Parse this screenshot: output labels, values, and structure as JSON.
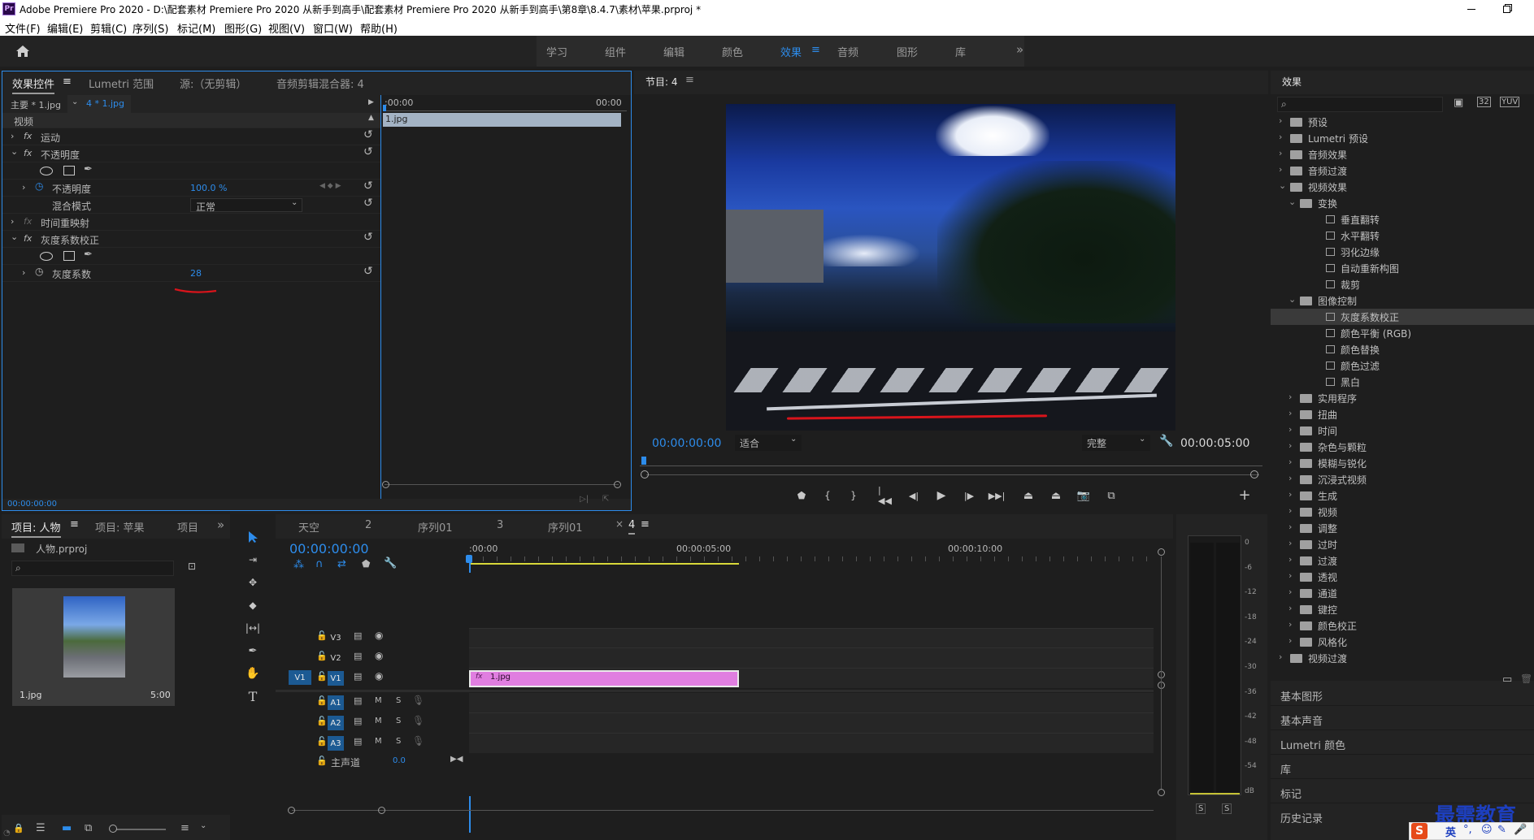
{
  "window": {
    "title": "Adobe Premiere Pro 2020 - D:\\配套素材 Premiere Pro 2020 从新手到高手\\配套素材 Premiere Pro 2020 从新手到高手\\第8章\\8.4.7\\素材\\苹果.prproj *",
    "app_icon_text": "Pr"
  },
  "menu": [
    "文件(F)",
    "编辑(E)",
    "剪辑(C)",
    "序列(S)",
    "标记(M)",
    "图形(G)",
    "视图(V)",
    "窗口(W)",
    "帮助(H)"
  ],
  "workspaces": [
    "学习",
    "组件",
    "编辑",
    "颜色",
    "效果",
    "音频",
    "图形",
    "库"
  ],
  "active_workspace": "效果",
  "effect_controls": {
    "tabs": [
      "效果控件",
      "Lumetri 范围",
      "源:（无剪辑）",
      "音频剪辑混合器: 4"
    ],
    "master_clip": "主要 * 1.jpg",
    "seq_clip": "4 * 1.jpg",
    "time_start": ":00:00",
    "time_end": "00:00",
    "clip_bar": "1.jpg",
    "section_video": "视频",
    "motion": "运动",
    "opacity": "不透明度",
    "opacity_param": "不透明度",
    "opacity_value": "100.0 %",
    "blend_mode_label": "混合模式",
    "blend_mode_value": "正常",
    "time_remap": "时间重映射",
    "gamma_effect": "灰度系数校正",
    "gamma_param": "灰度系数",
    "gamma_value": "28",
    "timecode": "00:00:00:00",
    "fx_label": "fx"
  },
  "program": {
    "title": "节目: 4",
    "timecode": "00:00:00:00",
    "fit": "适合",
    "quality": "完整",
    "duration": "00:00:05:00"
  },
  "project": {
    "tabs": [
      "项目: 人物",
      "项目: 苹果",
      "项目"
    ],
    "file": "人物.prproj",
    "clip_name": "1.jpg",
    "clip_duration": "5:00"
  },
  "timeline": {
    "tabs": [
      "天空",
      "2",
      "序列01",
      "3",
      "序列01",
      "4"
    ],
    "timecode": "00:00:00:00",
    "ruler": [
      ":00:00",
      "00:00:05:00",
      "00:00:10:00"
    ],
    "tracks_video": [
      "V3",
      "V2",
      "V1"
    ],
    "tracks_audio": [
      "A1",
      "A2",
      "A3"
    ],
    "source_patch": "V1",
    "master": "主声道",
    "master_value": "0.0",
    "clip": "1.jpg",
    "m_label": "M",
    "s_label": "S"
  },
  "meter": {
    "labels": [
      "0",
      "-6",
      "-12",
      "-18",
      "-24",
      "-30",
      "-36",
      "-42",
      "-48",
      "-54",
      "dB"
    ],
    "solo": [
      "S",
      "S"
    ]
  },
  "effects": {
    "title": "效果",
    "tree": [
      {
        "label": "预设",
        "indent": 0,
        "type": "folder",
        "open": false
      },
      {
        "label": "Lumetri 预设",
        "indent": 0,
        "type": "folder",
        "open": false
      },
      {
        "label": "音频效果",
        "indent": 0,
        "type": "folder",
        "open": false
      },
      {
        "label": "音频过渡",
        "indent": 0,
        "type": "folder",
        "open": false
      },
      {
        "label": "视频效果",
        "indent": 0,
        "type": "folder",
        "open": true
      },
      {
        "label": "变换",
        "indent": 1,
        "type": "folder",
        "open": true
      },
      {
        "label": "垂直翻转",
        "indent": 2,
        "type": "effect"
      },
      {
        "label": "水平翻转",
        "indent": 2,
        "type": "effect"
      },
      {
        "label": "羽化边缘",
        "indent": 2,
        "type": "effect"
      },
      {
        "label": "自动重新构图",
        "indent": 2,
        "type": "effect"
      },
      {
        "label": "裁剪",
        "indent": 2,
        "type": "effect"
      },
      {
        "label": "图像控制",
        "indent": 1,
        "type": "folder",
        "open": true
      },
      {
        "label": "灰度系数校正",
        "indent": 2,
        "type": "effect",
        "selected": true
      },
      {
        "label": "颜色平衡 (RGB)",
        "indent": 2,
        "type": "effect"
      },
      {
        "label": "颜色替换",
        "indent": 2,
        "type": "effect"
      },
      {
        "label": "颜色过滤",
        "indent": 2,
        "type": "effect"
      },
      {
        "label": "黑白",
        "indent": 2,
        "type": "effect"
      },
      {
        "label": "实用程序",
        "indent": 1,
        "type": "folder",
        "open": false
      },
      {
        "label": "扭曲",
        "indent": 1,
        "type": "folder",
        "open": false
      },
      {
        "label": "时间",
        "indent": 1,
        "type": "folder",
        "open": false
      },
      {
        "label": "杂色与颗粒",
        "indent": 1,
        "type": "folder",
        "open": false
      },
      {
        "label": "模糊与锐化",
        "indent": 1,
        "type": "folder",
        "open": false
      },
      {
        "label": "沉浸式视频",
        "indent": 1,
        "type": "folder",
        "open": false
      },
      {
        "label": "生成",
        "indent": 1,
        "type": "folder",
        "open": false
      },
      {
        "label": "视频",
        "indent": 1,
        "type": "folder",
        "open": false
      },
      {
        "label": "调整",
        "indent": 1,
        "type": "folder",
        "open": false
      },
      {
        "label": "过时",
        "indent": 1,
        "type": "folder",
        "open": false
      },
      {
        "label": "过渡",
        "indent": 1,
        "type": "folder",
        "open": false
      },
      {
        "label": "透视",
        "indent": 1,
        "type": "folder",
        "open": false
      },
      {
        "label": "通道",
        "indent": 1,
        "type": "folder",
        "open": false
      },
      {
        "label": "键控",
        "indent": 1,
        "type": "folder",
        "open": false
      },
      {
        "label": "颜色校正",
        "indent": 1,
        "type": "folder",
        "open": false
      },
      {
        "label": "风格化",
        "indent": 1,
        "type": "folder",
        "open": false
      },
      {
        "label": "视频过渡",
        "indent": 0,
        "type": "folder",
        "open": false
      }
    ],
    "sections": [
      "基本图形",
      "基本声音",
      "Lumetri 颜色",
      "库",
      "标记",
      "历史记录"
    ]
  },
  "watermark": "最需教育",
  "ime": {
    "logo": "S",
    "label": "英"
  },
  "colors": {
    "accent": "#2d8ceb",
    "clip_pink": "#e07ee0",
    "target_blue": "#1c5a93",
    "annotation_red": "#d9141b"
  }
}
